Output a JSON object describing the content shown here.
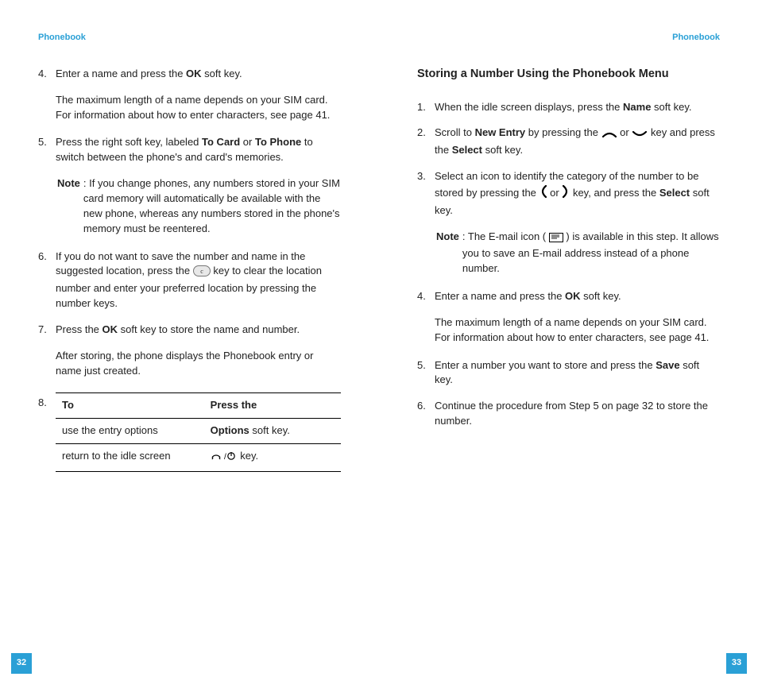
{
  "header_left": "Phonebook",
  "header_right": "Phonebook",
  "page_left_num": "32",
  "page_right_num": "33",
  "left": {
    "items": [
      {
        "n": "4.",
        "text_pre": "Enter a name and press the ",
        "bold1": "OK",
        "text_post": " soft key.",
        "sub": "The maximum length of a name depends on your SIM card. For information about how to enter characters, see page 41."
      },
      {
        "n": "5.",
        "text_a": "Press the right soft key, labeled ",
        "bold_a": "To Card",
        "text_b": " or ",
        "bold_b": "To Phone",
        "text_c": " to switch between the phone's and card's memories.",
        "note_label": "Note",
        "note_text": ": If you change phones, any numbers stored in your SIM card memory will automatically be available with the new phone, whereas any numbers stored in the phone's memory must be reentered."
      },
      {
        "n": "6.",
        "text_a": "If you do not want to save the number and name in the suggested location, press the ",
        "text_b": " key to clear the location number and enter your preferred location by pressing the number keys."
      },
      {
        "n": "7.",
        "text_a": "Press the ",
        "bold_a": "OK",
        "text_b": " soft key to store the name and number.",
        "sub": "After storing, the phone displays the Phonebook entry or name just created."
      }
    ],
    "table_n": "8.",
    "table": {
      "h1": "To",
      "h2": "Press the",
      "r1c1": "use the entry options",
      "r1c2_b": "Options",
      "r1c2_t": " soft key.",
      "r2c1": "return to the idle screen",
      "r2c2_t": " key."
    }
  },
  "right": {
    "title": "Storing a Number Using the Phonebook Menu",
    "items": [
      {
        "n": "1.",
        "t1": "When the idle screen displays, press the ",
        "b1": "Name",
        "t2": " soft key."
      },
      {
        "n": "2.",
        "t1": "Scroll to ",
        "b1": "New Entry",
        "t2": " by pressing the ",
        "t3": " or ",
        "t4": " key and press the ",
        "b2": "Select",
        "t5": " soft key."
      },
      {
        "n": "3.",
        "t1": "Select an icon to identify the category of the number to be stored by pressing the ",
        "t2": " or ",
        "t3": " key, and press the ",
        "b1": "Select",
        "t4": " soft key.",
        "note_label": "Note",
        "note_t1": ": The E-mail icon (",
        "note_t2": ") is available in this step. It allows you to save an E-mail address instead of a phone number."
      },
      {
        "n": "4.",
        "t1": "Enter a name and press the ",
        "b1": "OK",
        "t2": " soft key.",
        "sub": "The maximum length of a name depends on your SIM card. For information about how to enter characters, see page 41."
      },
      {
        "n": "5.",
        "t1": "Enter a number you want to store and press the ",
        "b1": "Save",
        "t2": " soft key."
      },
      {
        "n": "6.",
        "t1": "Continue the procedure from Step 5 on page 32 to store the number."
      }
    ]
  }
}
